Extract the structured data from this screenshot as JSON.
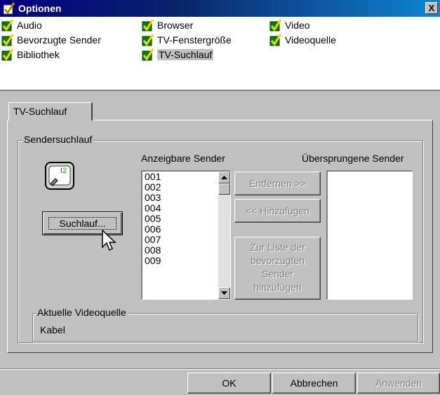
{
  "window": {
    "title": "Optionen",
    "close_label": "X"
  },
  "options": [
    {
      "label": "Audio"
    },
    {
      "label": "Browser"
    },
    {
      "label": "Video"
    },
    {
      "label": "Bevorzugte Sender"
    },
    {
      "label": "TV-Fenstergröße"
    },
    {
      "label": "Videoquelle"
    },
    {
      "label": "Bibliothek"
    },
    {
      "label": "TV-Suchlauf"
    }
  ],
  "tab": {
    "label": "TV-Suchlauf"
  },
  "sendersuchlauf": {
    "group_label": "Sendersuchlauf",
    "icon_text": "I2",
    "search_button": "Suchlauf...",
    "visible_label": "Anzeigbare Sender",
    "skipped_label": "Übersprungene Sender",
    "channels": [
      "001",
      "002",
      "003",
      "004",
      "005",
      "006",
      "007",
      "008",
      "009"
    ],
    "remove_button": "Entfernen >>",
    "add_button": "<< Hinzufügen",
    "favorites_button": [
      "Zur Liste der",
      "bevorzugten",
      "Sender",
      "hinzufügen"
    ]
  },
  "video_source": {
    "group_label": "Aktuelle Videoquelle",
    "value": "Kabel"
  },
  "footer": {
    "ok": "OK",
    "cancel": "Abbrechen",
    "apply": "Anwenden"
  }
}
